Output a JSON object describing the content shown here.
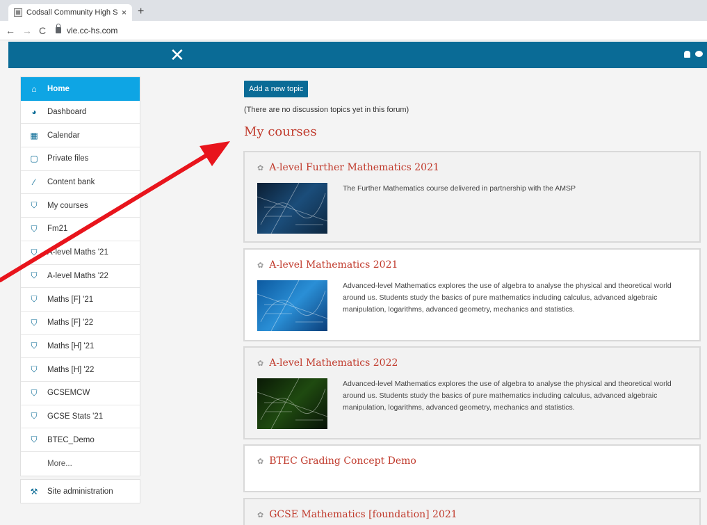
{
  "browser": {
    "tab_title": "Codsall Community High School",
    "tab_close": "×",
    "new_tab": "+",
    "url": "vle.cc-hs.com"
  },
  "topnav": {
    "close_label": "✕"
  },
  "sidebar": {
    "items": [
      {
        "label": "Home",
        "icon": "home-icon",
        "glyph": "⌂"
      },
      {
        "label": "Dashboard",
        "icon": "dashboard-icon",
        "glyph": "◕"
      },
      {
        "label": "Calendar",
        "icon": "calendar-icon",
        "glyph": "▦"
      },
      {
        "label": "Private files",
        "icon": "file-icon",
        "glyph": "▢"
      },
      {
        "label": "Content bank",
        "icon": "brush-icon",
        "glyph": "⁄"
      },
      {
        "label": "My courses",
        "icon": "graduation-cap-icon",
        "glyph": "⛉"
      },
      {
        "label": "Fm21",
        "icon": "graduation-cap-icon",
        "glyph": "⛉"
      },
      {
        "label": "A-level Maths '21",
        "icon": "graduation-cap-icon",
        "glyph": "⛉"
      },
      {
        "label": "A-level Maths '22",
        "icon": "graduation-cap-icon",
        "glyph": "⛉"
      },
      {
        "label": "Maths [F] '21",
        "icon": "graduation-cap-icon",
        "glyph": "⛉"
      },
      {
        "label": "Maths [F] '22",
        "icon": "graduation-cap-icon",
        "glyph": "⛉"
      },
      {
        "label": "Maths [H] '21",
        "icon": "graduation-cap-icon",
        "glyph": "⛉"
      },
      {
        "label": "Maths [H] '22",
        "icon": "graduation-cap-icon",
        "glyph": "⛉"
      },
      {
        "label": "GCSEMCW",
        "icon": "graduation-cap-icon",
        "glyph": "⛉"
      },
      {
        "label": "GCSE Stats '21",
        "icon": "graduation-cap-icon",
        "glyph": "⛉"
      },
      {
        "label": "BTEC_Demo",
        "icon": "graduation-cap-icon",
        "glyph": "⛉"
      }
    ],
    "more": "More...",
    "admin": {
      "label": "Site administration",
      "icon": "wrench-icon",
      "glyph": "⚒"
    }
  },
  "main": {
    "add_topic": "Add a new topic",
    "no_topics": "(There are no discussion topics yet in this forum)",
    "my_courses": "My courses",
    "courses": [
      {
        "title": "A-level Further Mathematics 2021",
        "description": "The Further Mathematics course delivered in partnership with the AMSP"
      },
      {
        "title": "A-level Mathematics 2021",
        "description": "Advanced-level Mathematics explores the use of algebra to analyse the physical and theoretical world around us. Students study the basics of pure mathematics including calculus, advanced algebraic manipulation, logarithms, advanced geometry, mechanics and statistics."
      },
      {
        "title": "A-level Mathematics 2022",
        "description": "Advanced-level Mathematics explores the use of algebra to analyse the physical and theoretical world around us. Students study the basics of pure mathematics including calculus, advanced algebraic manipulation, logarithms, advanced geometry, mechanics and statistics."
      },
      {
        "title": "BTEC Grading Concept Demo",
        "description": ""
      },
      {
        "title": "GCSE Mathematics [foundation] 2021",
        "description": ""
      }
    ]
  },
  "colors": {
    "brand": "#0a6b96",
    "active": "#0ea5e4",
    "heading": "#c0392b",
    "annotation": "#e8141c"
  }
}
